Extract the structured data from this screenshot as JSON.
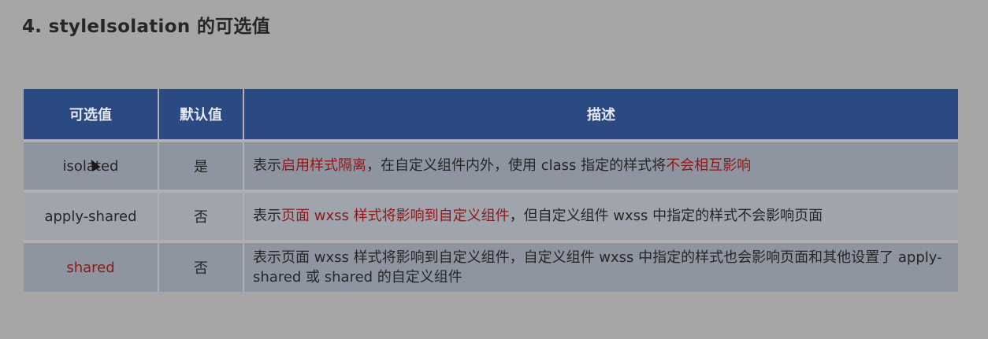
{
  "title": "4. styleIsolation 的可选值",
  "table": {
    "headers": [
      "可选值",
      "默认值",
      "描述"
    ],
    "rows": [
      {
        "value": "isolated",
        "default": "是",
        "desc": [
          {
            "text": "表示"
          },
          {
            "text": "启用样式隔离",
            "red": true
          },
          {
            "text": "，在自定义组件内外，使用 class 指定的样式将"
          },
          {
            "text": "不会相互影响",
            "red": true
          }
        ]
      },
      {
        "value": "apply-shared",
        "default": "否",
        "desc": [
          {
            "text": "表示"
          },
          {
            "text": "页面 wxss 样式将影响到自定义组件",
            "red": true
          },
          {
            "text": "，但自定义组件 wxss 中指定的样式不会影响页面"
          }
        ]
      },
      {
        "value": "shared",
        "value_color": "#8b1a1a",
        "default": "否",
        "desc": [
          {
            "text": "表示页面 wxss 样式将影响到自定义组件，自定义组件 wxss 中指定的样式也会影响页面和其他设置了 apply-shared 或 shared 的自定义组件"
          }
        ]
      }
    ]
  },
  "colors": {
    "header_bg": "#2b4a82",
    "highlight": "#8b1a1a",
    "page_bg": "#a6a6a6"
  },
  "icons": {
    "cursor": "mouse-pointer-icon"
  }
}
